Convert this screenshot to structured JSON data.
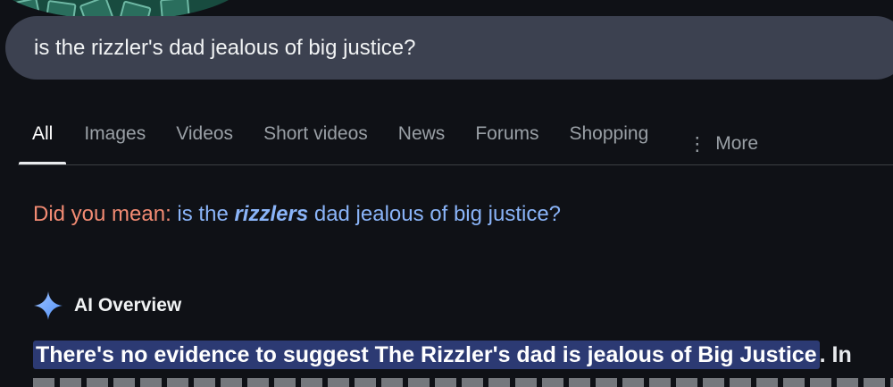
{
  "search": {
    "query": "is the rizzler's dad jealous of big justice?"
  },
  "tabs": [
    {
      "label": "All",
      "active": true
    },
    {
      "label": "Images",
      "active": false
    },
    {
      "label": "Videos",
      "active": false
    },
    {
      "label": "Short videos",
      "active": false
    },
    {
      "label": "News",
      "active": false
    },
    {
      "label": "Forums",
      "active": false
    },
    {
      "label": "Shopping",
      "active": false
    },
    {
      "label": "More",
      "active": false
    }
  ],
  "did_you_mean": {
    "label": "Did you mean:",
    "pre": "is the ",
    "emphasis": "rizzlers",
    "post": " dad jealous of big justice?"
  },
  "ai_overview": {
    "title": "AI Overview",
    "highlighted_text": "There's no evidence to suggest The Rizzler's dad is jealous of Big Justice",
    "trailing_text": ". In"
  },
  "colors": {
    "background": "#0f1116",
    "search_bar": "#3c4150",
    "link": "#8ab4f8",
    "did_you_mean_label": "#f28b73",
    "highlight": "#2c3a73"
  },
  "icons": {
    "more": "kebab-vertical-icon",
    "ai": "gemini-sparkle-icon"
  }
}
